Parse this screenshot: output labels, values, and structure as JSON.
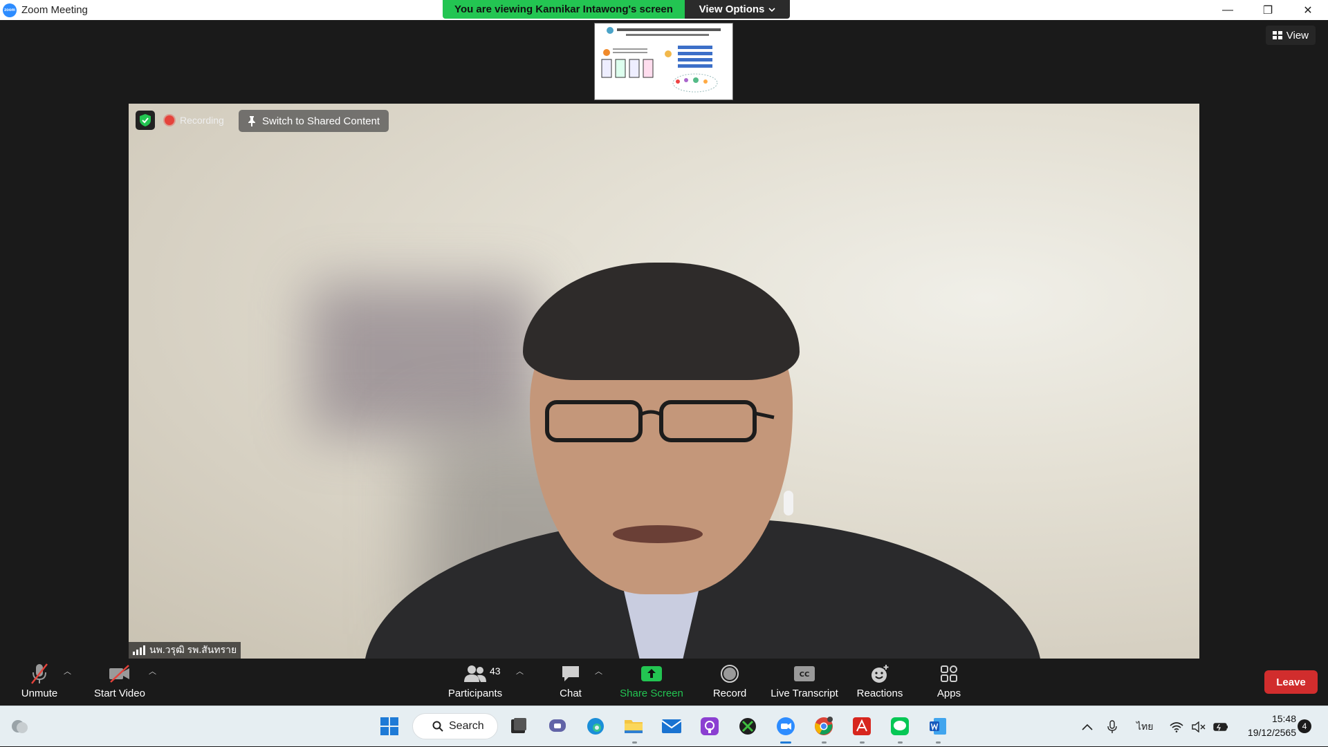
{
  "window": {
    "title": "Zoom Meeting",
    "controls": {
      "minimize": "—",
      "restore": "❐",
      "close": "✕"
    }
  },
  "share_banner": {
    "viewing_text": "You are viewing Kannikar Intawong's screen",
    "view_options_label": "View Options",
    "view_options_icon": "chevron-down-icon"
  },
  "top_right": {
    "view_label": "View"
  },
  "video": {
    "recording_label": "Recording",
    "switch_label": "Switch to Shared Content",
    "participant_name": "นพ.วรุฒิ รพ.สันทราย"
  },
  "toolbar": {
    "unmute": "Unmute",
    "start_video": "Start Video",
    "participants": "Participants",
    "participants_count": "43",
    "chat": "Chat",
    "share_screen": "Share Screen",
    "record": "Record",
    "live_transcript": "Live Transcript",
    "cc_text": "CC",
    "reactions": "Reactions",
    "apps": "Apps",
    "leave": "Leave"
  },
  "colors": {
    "share_green": "#23c552",
    "leave_red": "#d12d2d",
    "zoom_blue": "#2d8cff"
  },
  "taskbar": {
    "search_label": "Search",
    "language": "ไทย",
    "time": "15:48",
    "date": "19/12/2565",
    "notification_count": "4"
  }
}
